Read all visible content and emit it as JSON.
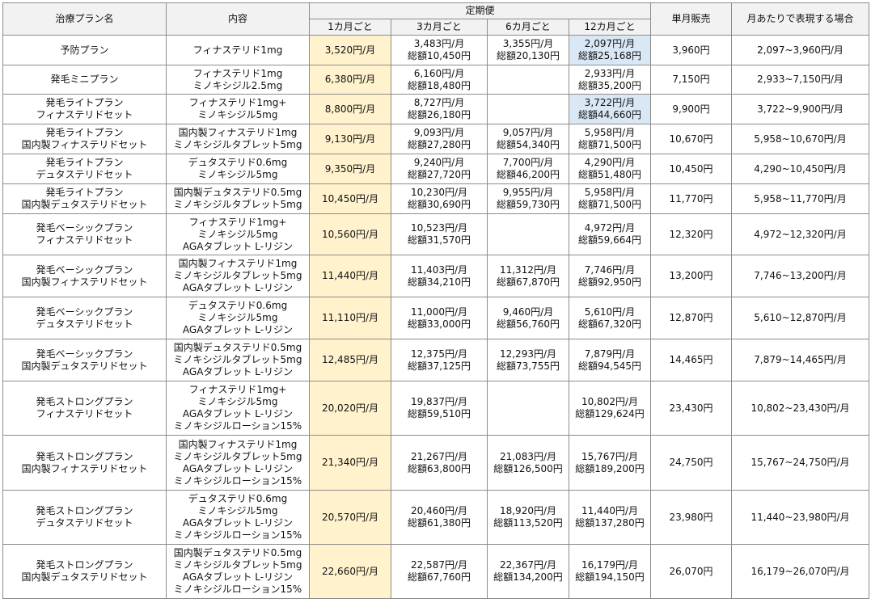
{
  "header": {
    "plan_name": "治療プラン名",
    "contents": "内容",
    "subscription": "定期便",
    "m1": "1カ月ごと",
    "m3": "3カ月ごと",
    "m6": "6カ月ごと",
    "m12": "12カ月ごと",
    "single": "単月販売",
    "monthly_expr": "月あたりで表現する場合"
  },
  "rows": [
    {
      "name": [
        "予防プラン"
      ],
      "content": [
        "フィナステリド1mg"
      ],
      "m1": "3,520円/月",
      "m3": [
        "3,483円/月",
        "総額10,450円"
      ],
      "m6": [
        "3,355円/月",
        "総額20,130円"
      ],
      "m12": [
        "2,097円/月",
        "総額25,168円"
      ],
      "m12_highlight": true,
      "single": "3,960円",
      "range": "2,097~3,960円/月"
    },
    {
      "name": [
        "発毛ミニプラン"
      ],
      "content": [
        "フィナステリド1mg",
        "ミノキシジル2.5mg"
      ],
      "m1": "6,380円/月",
      "m3": [
        "6,160円/月",
        "総額18,480円"
      ],
      "m6": [],
      "m12": [
        "2,933円/月",
        "総額35,200円"
      ],
      "m12_highlight": false,
      "single": "7,150円",
      "range": "2,933~7,150円/月"
    },
    {
      "name": [
        "発毛ライトプラン",
        "フィナステリドセット"
      ],
      "content": [
        "フィナステリド1mg+",
        "ミノキシジル5mg"
      ],
      "m1": "8,800円/月",
      "m3": [
        "8,727円/月",
        "総額26,180円"
      ],
      "m6": [],
      "m12": [
        "3,722円/月",
        "総額44,660円"
      ],
      "m12_highlight": true,
      "single": "9,900円",
      "range": "3,722~9,900円/月"
    },
    {
      "name": [
        "発毛ライトプラン",
        "国内製フィナステリドセット"
      ],
      "content": [
        "国内製フィナステリド1mg",
        "ミノキシジルタブレット5mg"
      ],
      "m1": "9,130円/月",
      "m3": [
        "9,093円/月",
        "総額27,280円"
      ],
      "m6": [
        "9,057円/月",
        "総額54,340円"
      ],
      "m12": [
        "5,958円/月",
        "総額71,500円"
      ],
      "m12_highlight": false,
      "single": "10,670円",
      "range": "5,958~10,670円/月"
    },
    {
      "name": [
        "発毛ライトプラン",
        "デュタステリドセット"
      ],
      "content": [
        "デュタステリド0.6mg",
        "ミノキシジル5mg"
      ],
      "m1": "9,350円/月",
      "m3": [
        "9,240円/月",
        "総額27,720円"
      ],
      "m6": [
        "7,700円/月",
        "総額46,200円"
      ],
      "m12": [
        "4,290円/月",
        "総額51,480円"
      ],
      "m12_highlight": false,
      "single": "10,450円",
      "range": "4,290~10,450円/月"
    },
    {
      "name": [
        "発毛ライトプラン",
        "国内製デュタステリドセット"
      ],
      "content": [
        "国内製デュタステリド0.5mg",
        "ミノキシジルタブレット5mg"
      ],
      "m1": "10,450円/月",
      "m3": [
        "10,230円/月",
        "総額30,690円"
      ],
      "m6": [
        "9,955円/月",
        "総額59,730円"
      ],
      "m12": [
        "5,958円/月",
        "総額71,500円"
      ],
      "m12_highlight": false,
      "single": "11,770円",
      "range": "5,958~11,770円/月"
    },
    {
      "name": [
        "発毛ベーシックプラン",
        "フィナステリドセット"
      ],
      "content": [
        "フィナステリド1mg+",
        "ミノキシジル5mg",
        "AGAタブレット L-リジン"
      ],
      "m1": "10,560円/月",
      "m3": [
        "10,523円/月",
        "総額31,570円"
      ],
      "m6": [],
      "m12": [
        "4,972円/月",
        "総額59,664円"
      ],
      "m12_highlight": false,
      "single": "12,320円",
      "range": "4,972~12,320円/月"
    },
    {
      "name": [
        "発毛ベーシックプラン",
        "国内製フィナステリドセット"
      ],
      "content": [
        "国内製フィナステリド1mg",
        "ミノキシジルタブレット5mg",
        "AGAタブレット L-リジン"
      ],
      "m1": "11,440円/月",
      "m3": [
        "11,403円/月",
        "総額34,210円"
      ],
      "m6": [
        "11,312円/月",
        "総額67,870円"
      ],
      "m12": [
        "7,746円/月",
        "総額92,950円"
      ],
      "m12_highlight": false,
      "single": "13,200円",
      "range": "7,746~13,200円/月"
    },
    {
      "name": [
        "発毛ベーシックプラン",
        "デュタステリドセット"
      ],
      "content": [
        "デュタステリド0.6mg",
        "ミノキシジル5mg",
        "AGAタブレット L-リジン"
      ],
      "m1": "11,110円/月",
      "m3": [
        "11,000円/月",
        "総額33,000円"
      ],
      "m6": [
        "9,460円/月",
        "総額56,760円"
      ],
      "m12": [
        "5,610円/月",
        "総額67,320円"
      ],
      "m12_highlight": false,
      "single": "12,870円",
      "range": "5,610~12,870円/月"
    },
    {
      "name": [
        "発毛ベーシックプラン",
        "国内製デュタステリドセット"
      ],
      "content": [
        "国内製デュタステリド0.5mg",
        "ミノキシジルタブレット5mg",
        "AGAタブレット L-リジン"
      ],
      "m1": "12,485円/月",
      "m3": [
        "12,375円/月",
        "総額37,125円"
      ],
      "m6": [
        "12,293円/月",
        "総額73,755円"
      ],
      "m12": [
        "7,879円/月",
        "総額94,545円"
      ],
      "m12_highlight": false,
      "single": "14,465円",
      "range": "7,879~14,465円/月"
    },
    {
      "name": [
        "発毛ストロングプラン",
        "フィナステリドセット"
      ],
      "content": [
        "フィナステリド1mg+",
        "ミノキシジル5mg",
        "AGAタブレット L-リジン",
        "ミノキシジルローション15%"
      ],
      "m1": "20,020円/月",
      "m3": [
        "19,837円/月",
        "総額59,510円"
      ],
      "m6": [],
      "m12": [
        "10,802円/月",
        "総額129,624円"
      ],
      "m12_highlight": false,
      "single": "23,430円",
      "range": "10,802~23,430円/月"
    },
    {
      "name": [
        "発毛ストロングプラン",
        "国内製フィナステリドセット"
      ],
      "content": [
        "国内製フィナステリド1mg",
        "ミノキシジルタブレット5mg",
        "AGAタブレット L-リジン",
        "ミノキシジルローション15%"
      ],
      "m1": "21,340円/月",
      "m3": [
        "21,267円/月",
        "総額63,800円"
      ],
      "m6": [
        "21,083円/月",
        "総額126,500円"
      ],
      "m12": [
        "15,767円/月",
        "総額189,200円"
      ],
      "m12_highlight": false,
      "single": "24,750円",
      "range": "15,767~24,750円/月"
    },
    {
      "name": [
        "発毛ストロングプラン",
        "デュタステリドセット"
      ],
      "content": [
        "デュタステリド0.6mg",
        "ミノキシジル5mg",
        "AGAタブレット L-リジン",
        "ミノキシジルローション15%"
      ],
      "m1": "20,570円/月",
      "m3": [
        "20,460円/月",
        "総額61,380円"
      ],
      "m6": [
        "18,920円/月",
        "総額113,520円"
      ],
      "m12": [
        "11,440円/月",
        "総額137,280円"
      ],
      "m12_highlight": false,
      "single": "23,980円",
      "range": "11,440~23,980円/月"
    },
    {
      "name": [
        "発毛ストロングプラン",
        "国内製デュタステリドセット"
      ],
      "content": [
        "国内製デュタステリド0.5mg",
        "ミノキシジルタブレット5mg",
        "AGAタブレット L-リジン",
        "ミノキシジルローション15%"
      ],
      "m1": "22,660円/月",
      "m3": [
        "22,587円/月",
        "総額67,760円"
      ],
      "m6": [
        "22,367円/月",
        "総額134,200円"
      ],
      "m12": [
        "16,179円/月",
        "総額194,150円"
      ],
      "m12_highlight": false,
      "single": "26,070円",
      "range": "16,179~26,070円/月"
    }
  ],
  "colors": {
    "one_month_bg": "#fff2cc",
    "highlight_bg": "#dae8f6",
    "header_bg": "#f2f2f2",
    "border": "#8c8c8c"
  }
}
